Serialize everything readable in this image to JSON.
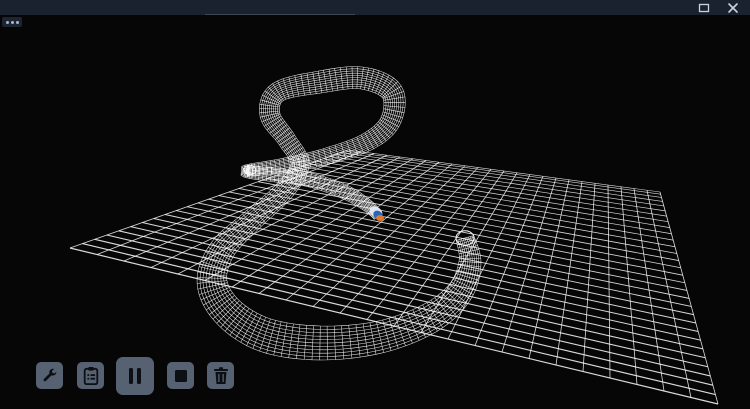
{
  "window": {
    "maximize_icon": "maximize-icon",
    "close_icon": "close-icon"
  },
  "menu": {
    "icon": "more-dots-icon"
  },
  "scene": {
    "grid_color": "#ffffff",
    "wire_color": "#ffffff",
    "background": "#060606",
    "tip_colors": [
      "#e0e6ef",
      "#2b65b8",
      "#e07a2c"
    ]
  },
  "toolbar": {
    "buttons": [
      {
        "name": "settings-button",
        "icon": "wrench-icon"
      },
      {
        "name": "clipboard-button",
        "icon": "clipboard-list-icon"
      },
      {
        "name": "pause-button",
        "icon": "pause-icon"
      },
      {
        "name": "stop-button",
        "icon": "stop-icon"
      },
      {
        "name": "delete-button",
        "icon": "trash-icon"
      }
    ],
    "button_color": "#566172",
    "icon_color": "#0c0f14"
  }
}
